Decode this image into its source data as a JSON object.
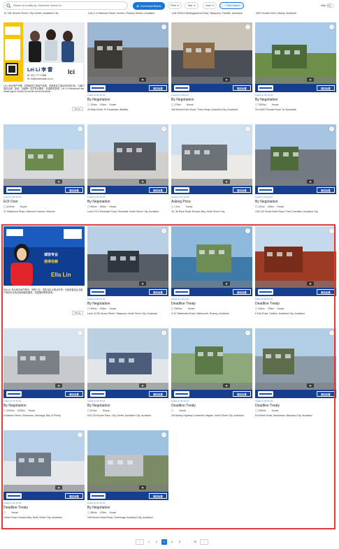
{
  "topbar": {
    "search_placeholder": "Search by locality eg. Hamurera, Epsom ra...",
    "commercial_button": "Commercial Brands",
    "price_label": "Price",
    "type_label": "Size",
    "more_label": "more",
    "save_label": "Save search",
    "map_label": "Map"
  },
  "previous_row": [
    "Ki 128 Vincent Street, City Centre, Auckland City",
    "Lots 2-4 Harwood Street, Kumeu, Rodney District, Auckland",
    "Unit 40B/14 Whangaparoa Road, Takapuna, Franklin, Auckland",
    "28/3 Oxnide Drive, Albany, Auckland"
  ],
  "promo1": {
    "name": "Lei Li",
    "description": "Lei Li专业房产代理，持有新西兰房地产执照，熟悉奥克兰各区域市场行情，为客户提供买卖、投资、出租等一站式专业服务，欢迎联系咨询。Lei Li Professional real estate agent, trusted by clients across Auckland.",
    "button": "Phone"
  },
  "promo2": {
    "name": "Ella Lin",
    "description": "Ella Lin 专业商业地产顾问，熟悉工业、零售及办公物业市场，为投资者及企业客户提供专业的买卖和租赁服务，欢迎随时联系咨询。",
    "button": "Phone"
  },
  "cards": [
    {
      "date": "Listed on 26 Jul 24",
      "price": "By Negotiation",
      "f1": "126m²",
      "f2": "134m²",
      "f3": "House",
      "addr": "43 Main Road, Te Kauwhata, Waikato"
    },
    {
      "date": "Listed on 2 Aug 24",
      "price": "By Negotiation",
      "f1": "175m²",
      "f2": "",
      "f3": "House",
      "addr": "166 Mount Eden Road, Three Kings, Auckland City, Auckland"
    },
    {
      "date": "Listed on 30 Jul 24",
      "price": "By Negotiation",
      "f1": "7500m²",
      "f2": "",
      "f3": "House",
      "addr": "2/4 4449 Thomas Road, Te Kauwhata"
    },
    {
      "date": "Listed on 28 Jul 24",
      "price": "EOI Over",
      "f1": "4200m²",
      "f2": "",
      "f3": "House",
      "addr": "21 Gladstone Road, Diamond Central, Osborne"
    },
    {
      "date": "Listed on 31 Jul 24",
      "price": "By Negotiation",
      "f1": "960m²",
      "f2": "960m²",
      "f3": "House",
      "addr": "Land 2+12 Rosedale Road, Rosedale, North Shore City, Auckland"
    },
    {
      "date": "Listed on 25 Jul 24",
      "price": "Asking Price",
      "f1": "1 km²",
      "f2": "",
      "f3": "House",
      "addr": "28, 46 Rose Road, Browns Bay, North Shore City"
    },
    {
      "date": "Listed on 8 Aug 24",
      "price": "By Negotiation",
      "f1": "120m²",
      "f2": "400m²",
      "f3": "House",
      "addr": "139-142 Great North Road, Point Chevalier, Auckland City"
    },
    {
      "date": "Listed on 30 Jul 24",
      "price": "By Negotiation",
      "f1": "960m²",
      "f2": "240m²",
      "f3": "House",
      "addr": "Level 12-82 Anzac Street, Takapuna, North Shore City, Auckland"
    },
    {
      "date": "Listed on 1 Aug 24",
      "price": "Deadline Treaty",
      "f1": "2960m²",
      "f2": "",
      "f3": "House",
      "addr": "2/ 67 Waterview Road, Warkworth, Rodney, Auckland"
    },
    {
      "date": "Listed on 28 Jul 24",
      "price": "Deadline Treaty",
      "f1": "440m²",
      "f2": "780m²",
      "f3": "House",
      "addr": "6 City Road, Grafton, Auckland City, Auckland"
    },
    {
      "date": "Listed on 31 Jul 24",
      "price": "By Negotiation",
      "f1": "2000m²",
      "f2": "1525m²",
      "f3": "House",
      "addr": "6 Malone Street, Omanawa, Tauranga, Bay of Plenty"
    },
    {
      "date": "Listed on 31 Jul 24",
      "price": "By Negotiation",
      "f1": "874m²",
      "f2": "",
      "f3": "House",
      "addr": "6/22-26 Khyber Pass, City Centre, Auckland City, Auckland"
    },
    {
      "date": "Listed on 26 Jul 24",
      "price": "Deadline Treaty",
      "f1": "",
      "f2": "",
      "f3": "House",
      "addr": "4/5 Albany Highway, Unsworth Heights, North Shore City, Auckland"
    },
    {
      "date": "Listed on 28 Jul 24",
      "price": "Deadline Treaty",
      "f1": "3250m²",
      "f2": "",
      "f3": "House",
      "addr": "6-8 Mirek Road, Manurewa, Manukau City, Auckland"
    },
    {
      "date": "Listed on 31 Jul 24",
      "price": "Deadline Treaty",
      "f1": "",
      "f2": "",
      "f3": "House",
      "addr": "4 Bute Road, Browns Bay, North Shore City, Auckland"
    },
    {
      "date": "Listed on 31 Jul 24",
      "price": "By Negotiation",
      "f1": "480m²",
      "f2": "130m²",
      "f3": "House",
      "addr": "248 Mount Smart Road, Onehunga, Auckland City, Auckland"
    }
  ],
  "tag_label": "面议出售",
  "pager": {
    "prev": "‹",
    "next": "›",
    "p1": "1",
    "p2": "2",
    "p3": "3",
    "p4": "4",
    "p5": "5",
    "dots": "…",
    "last": "76"
  }
}
